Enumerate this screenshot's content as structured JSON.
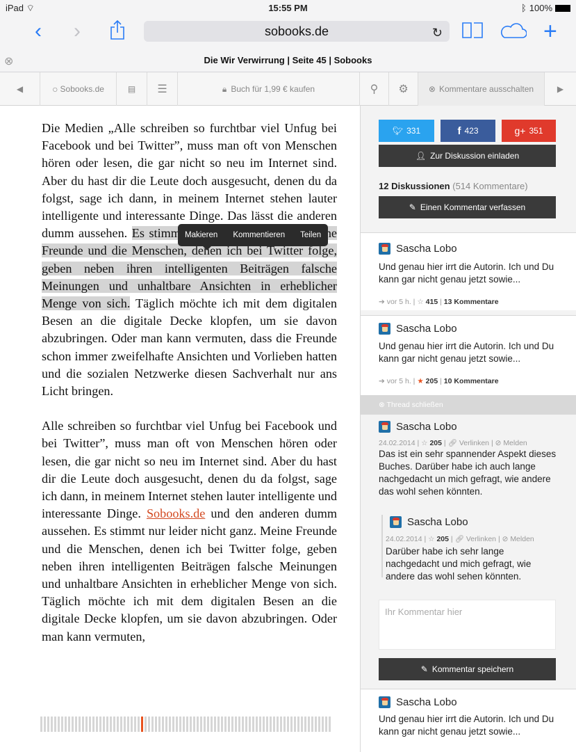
{
  "status": {
    "device": "iPad",
    "time": "15:55 PM",
    "battery": "100%"
  },
  "browser": {
    "url": "sobooks.de",
    "tab_title": "Die Wir Verwirrung  |  Seite 45  | Sobooks"
  },
  "toolbar": {
    "home_label": "Sobooks.de",
    "buy_label": "Buch für 1,99 € kaufen",
    "comments_off_label": "Kommentare ausschalten"
  },
  "selection_menu": {
    "items": [
      "Makieren",
      "Kommentieren",
      "Teilen"
    ]
  },
  "article": {
    "p1_a": "Die Medien „Alle schreiben so furchtbar viel Unfug bei Facebook und bei Twitter”, muss man oft von Menschen hören oder lesen, die gar nicht so neu im Internet sind. Aber du hast dir die Leute doch ausgesucht, denen du da folgst, sage ich dann, in meinem Internet stehen lauter intelligente und interessante Dinge. Das lässt die anderen dumm aussehen.",
    "p1_hl": "Es stimmt nur leider nicht ganz. Meine Freunde und die Menschen, denen ich bei Twitter folge, geben neben ihren intelligenten Beiträgen falsche Meinungen und unhaltbare Ansichten in erheblicher Menge von sich.",
    "p1_b": "Täglich möchte ich mit dem digitalen Besen an die digitale Decke klopfen, um sie davon abzubringen. Oder man kann vermuten, dass die Freunde schon immer zweifelhafte Ansichten und Vorlieben hatten und die sozialen Netzwerke diesen Sachverhalt nur ans Licht bringen.",
    "p2_a": "Alle schreiben so furchtbar viel Unfug bei Facebook und bei Twitter”, muss man oft von Menschen hören oder lesen, die gar nicht so neu im Internet sind. Aber du hast dir die Leute doch ausgesucht, denen du da folgst, sage ich dann, in meinem Internet stehen lauter intelligente und interessante Dinge.",
    "p2_link": "Sobooks.de",
    "p2_b": "und den anderen dumm aussehen. Es stimmt nur leider nicht ganz. Meine Freunde und die Menschen, denen ich bei Twitter folge, geben neben ihren intelligenten Beiträgen falsche Meinungen und unhaltbare Ansichten in erheblicher Menge von sich. Täglich möchte ich mit dem digitalen Besen an die digitale Decke klopfen, um sie davon abzubringen. Oder man kann vermuten,"
  },
  "reading_progress": 0.35,
  "share": {
    "twitter": "331",
    "facebook": "423",
    "gplus": "351"
  },
  "invite_label": "Zur Diskussion einladen",
  "discussions": {
    "count": "12 Diskussionen",
    "comments": "(514 Kommentare)"
  },
  "write_comment_label": "Einen Kommentar verfassen",
  "cards": [
    {
      "author": "Sascha Lobo",
      "text": "Und genau hier irrt die Autorin. Ich und Du kann gar nicht genau jetzt sowie...",
      "time": "vor 5 h.",
      "likes": "415",
      "comments": "13 Kommentare"
    },
    {
      "author": "Sascha Lobo",
      "text": "Und genau hier irrt die Autorin. Ich und Du kann gar nicht genau jetzt sowie...",
      "time": "vor 5 h.",
      "likes": "205",
      "comments": "10 Kommentare"
    }
  ],
  "thread": {
    "close_label": "Thread schließen",
    "post": {
      "author": "Sascha Lobo",
      "date": "24.02.2014",
      "likes": "205",
      "link": "Verlinken",
      "report": "Melden",
      "text": "Das ist ein sehr spannender Aspekt dieses Buches. Darüber habe ich auch lange nachgedacht un mich gefragt, wie andere das wohl sehen könnten."
    },
    "reply": {
      "author": "Sascha Lobo",
      "date": "24.02.2014",
      "likes": "205",
      "link": "Verlinken",
      "report": "Melden",
      "text": "Darüber habe ich sehr lange nachgedacht und mich gefragt, wie andere das wohl sehen könnten."
    },
    "input_placeholder": "Ihr Kommentar hier",
    "save_label": "Kommentar speichern"
  },
  "last_card": {
    "author": "Sascha Lobo",
    "text": "Und genau hier irrt die Autorin. Ich und Du kann gar nicht genau jetzt sowie..."
  },
  "colors": {
    "twitter": "#2aa3ef",
    "facebook": "#3a5c9c",
    "gplus": "#e03a2c",
    "accent": "#e9531f",
    "ios_blue": "#2a7cf6"
  }
}
